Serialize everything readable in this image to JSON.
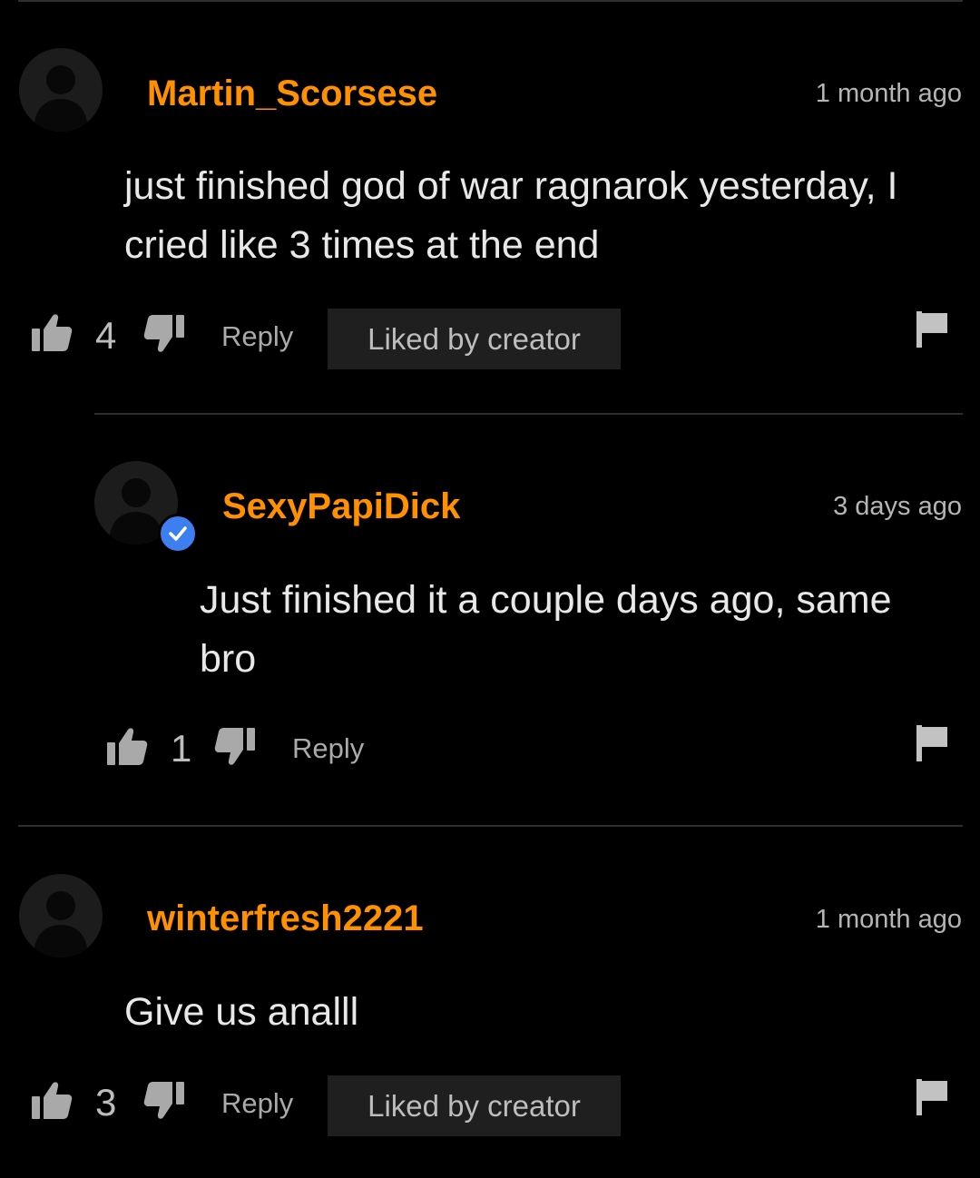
{
  "theme": {
    "background": "#000000",
    "accent": "#ff9000",
    "verified_color": "#3d7ff0"
  },
  "comments": [
    {
      "username": "Martin_Scorsese",
      "timestamp": "1 month ago",
      "text": "just finished god of war ragnarok yesterday, I cried like 3 times at the end",
      "likes": "4",
      "reply_label": "Reply",
      "badge": "Liked by creator",
      "avatar_icon": "user-silhouette-icon"
    },
    {
      "username": "SexyPapiDick",
      "timestamp": "3 days ago",
      "text": "Just finished it a couple days ago, same bro",
      "likes": "1",
      "reply_label": "Reply",
      "verified": true,
      "verified_icon": "checkmark-icon",
      "avatar_icon": "user-silhouette-icon"
    },
    {
      "username": "winterfresh2221",
      "timestamp": "1 month ago",
      "text": "Give us analll",
      "likes": "3",
      "reply_label": "Reply",
      "badge": "Liked by creator",
      "avatar_icon": "user-silhouette-icon"
    }
  ],
  "icons": {
    "like": "thumbs-up-icon",
    "dislike": "thumbs-down-icon",
    "report": "flag-icon"
  }
}
